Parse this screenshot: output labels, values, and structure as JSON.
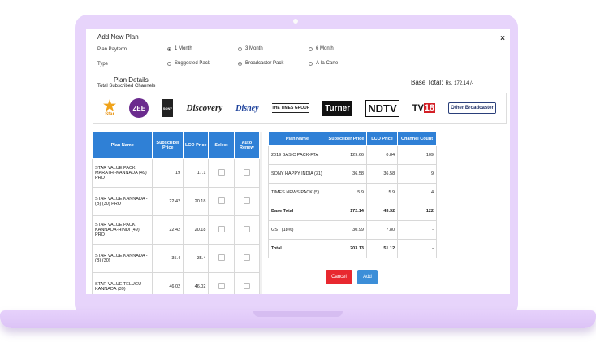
{
  "modal": {
    "title": "Add New Plan",
    "close_label": "×",
    "plan_payterm": {
      "label": "Plan Payterm",
      "options": [
        "1 Month",
        "3 Month",
        "6 Month"
      ],
      "selected": "1 Month"
    },
    "type": {
      "label": "Type",
      "options": [
        "Suggested Pack",
        "Broadcaster Pack",
        "A-la-Carte"
      ],
      "selected": "Broadcaster Pack"
    },
    "plan_details_title": "Plan Details",
    "total_subscribed_label": "Total Subscribed Channels",
    "base_total_label": "Base Total:",
    "base_total_value": "Rs. 172.14 /-"
  },
  "broadcasters": [
    {
      "icon": "star-logo",
      "text": "Star"
    },
    {
      "icon": "zee-logo",
      "text": "ZEE"
    },
    {
      "icon": "sony-logo",
      "text": "SONY"
    },
    {
      "icon": "discovery-logo",
      "text": "Discovery"
    },
    {
      "icon": "disney-logo",
      "text": "Disney"
    },
    {
      "icon": "times-group-logo",
      "text": "THE TIMES GROUP"
    },
    {
      "icon": "turner-logo",
      "text": "Turner"
    },
    {
      "icon": "ndtv-logo",
      "text": "NDTV"
    },
    {
      "icon": "tv18-logo",
      "text": "TV18"
    }
  ],
  "other_broadcaster_label": "Other Broadcaster",
  "left_table": {
    "headers": [
      "Plan Name",
      "Subscriber Price",
      "LCO Price",
      "Select",
      "Auto Renew"
    ],
    "rows": [
      {
        "name": "STAR VALUE PACK MARATHI-KANNADA (49) PRO",
        "subscriber": "19",
        "lco": "17.1"
      },
      {
        "name": "STAR VALUE KANNADA -(B) (30) PRO",
        "subscriber": "22.42",
        "lco": "20.18"
      },
      {
        "name": "STAR VALUE PACK KANNADA-HINDI (49) PRO",
        "subscriber": "22.42",
        "lco": "20.18"
      },
      {
        "name": "STAR VALUE KANNADA -(B) (30)",
        "subscriber": "35.4",
        "lco": "35.4"
      },
      {
        "name": "STAR VALUE TELUGU-KANNADA (39)",
        "subscriber": "46.02",
        "lco": "46.02"
      }
    ]
  },
  "right_table": {
    "headers": [
      "Plan Name",
      "Subscriber Price",
      "LCO Price",
      "Channel Count"
    ],
    "rows": [
      {
        "name": "2019 BASIC PACK-FTA",
        "subscriber": "129.66",
        "lco": "0.84",
        "count": "109"
      },
      {
        "name": "SONY HAPPY INDIA (31)",
        "subscriber": "36.58",
        "lco": "36.58",
        "count": "9"
      },
      {
        "name": "TIMES NEWS PACK (5)",
        "subscriber": "5.9",
        "lco": "5.9",
        "count": "4"
      }
    ],
    "base_total": {
      "name": "Base Total",
      "subscriber": "172.14",
      "lco": "43.32",
      "count": "122"
    },
    "gst": {
      "name": "GST (18%)",
      "subscriber": "30.99",
      "lco": "7.80",
      "count": "-"
    },
    "total": {
      "name": "Total",
      "subscriber": "203.13",
      "lco": "51.12",
      "count": "-"
    }
  },
  "buttons": {
    "cancel": "Cancel",
    "add": "Add"
  },
  "colors": {
    "laptop": "#e7d4fb",
    "table_header": "#2f80d6",
    "cancel": "#e8282f",
    "add": "#3c8ed8"
  }
}
